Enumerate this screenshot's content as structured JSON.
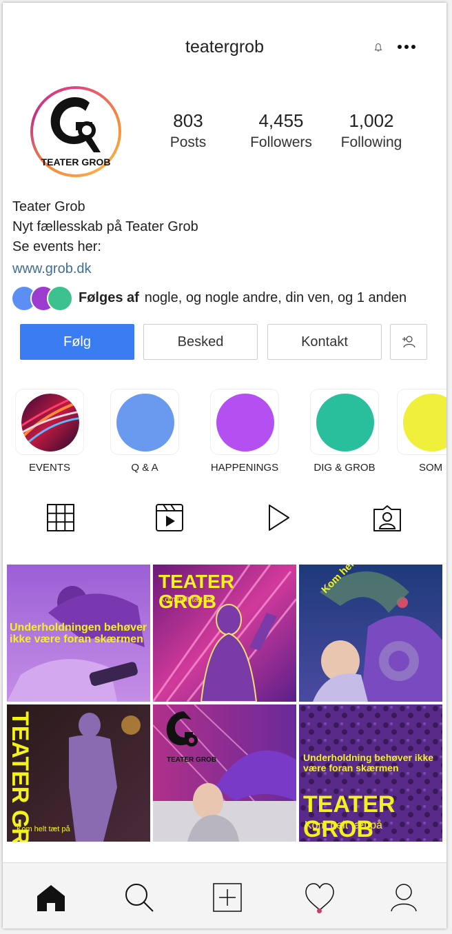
{
  "profile": {
    "username": "teatergrob",
    "logo_text": "TEATER GROB",
    "stats": [
      {
        "num": "803",
        "label": "Posts"
      },
      {
        "num": "4,455",
        "label": "Followers"
      },
      {
        "num": "1,002",
        "label": "Following"
      }
    ],
    "bio": {
      "name": "Teater Grob",
      "line1": "Nyt fællesskab på Teater Grob",
      "line2": "Se events her:",
      "link": "www.grob.dk"
    },
    "followed_by": {
      "prefix": "Følges af",
      "text": "nogle, og nogle andre, din ven, og 1 anden",
      "avatar_colors": [
        "#5b8ff3",
        "#9b3bd0",
        "#3dc28f"
      ]
    }
  },
  "buttons": {
    "follow": "Følg",
    "message": "Besked",
    "contact": "Kontakt",
    "add_user_icon": "add-person-icon"
  },
  "highlights": [
    {
      "label": "EVENTS",
      "color": "#b8243f"
    },
    {
      "label": "Q & A",
      "color": "#6a9af0"
    },
    {
      "label": "HAPPENINGS",
      "color": "#b44ff2"
    },
    {
      "label": "DIG & GROB",
      "color": "#29bf9c"
    },
    {
      "label": "SOM",
      "color": "#f0ef3c"
    }
  ],
  "tabs": [
    "grid-icon",
    "reels-icon",
    "play-icon",
    "tagged-icon"
  ],
  "posts": [
    {
      "caption": "Underholdningen behøver ikke være foran skærmen"
    },
    {
      "title": "TEATER GROB",
      "subtitle": "Kom helt tæt på"
    },
    {
      "caption": "Kom helt tæt på"
    },
    {
      "title": "TEATER GROB",
      "subtitle": "Kom helt tæt på"
    },
    {
      "title": "TEATER GROB"
    },
    {
      "caption": "Underholdning behøver ikke være foran skærmen",
      "title": "TEATER GROB",
      "subtitle": "Kom helt tæt på"
    }
  ],
  "nav": [
    "home-icon",
    "search-icon",
    "add-post-icon",
    "heart-icon",
    "profile-icon"
  ],
  "colors": {
    "accent": "#3a7cf2",
    "link": "#3f6d98",
    "post_yellow": "#f4f21c",
    "notification_dot": "#c2416e"
  }
}
